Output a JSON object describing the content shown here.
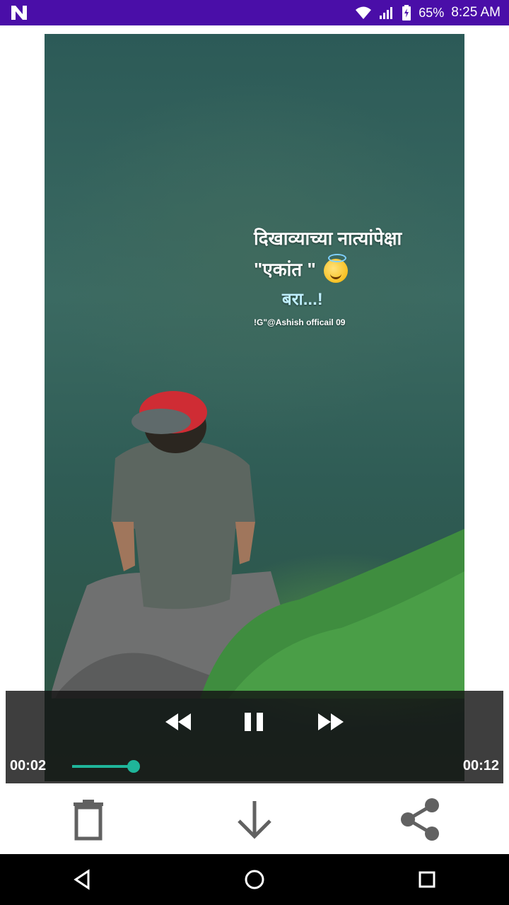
{
  "status_bar": {
    "battery": "65%",
    "time": "8:25 AM",
    "background": "#4a0ea8",
    "icons": [
      "notification-n-icon",
      "wifi-icon",
      "signal-icon",
      "battery-icon"
    ]
  },
  "video": {
    "overlay_text": {
      "line1": "दिखाव्याच्या नात्यांपेक्षा",
      "line2": "\"एकांत \"",
      "line3": "बरा...!",
      "credit": "!G\"@Ashish officail 09"
    }
  },
  "player": {
    "current_time": "00:02",
    "total_time": "00:12",
    "progress_fraction": 0.167,
    "accent": "#1fb59a",
    "buttons": [
      "rewind-icon",
      "pause-icon",
      "fast-forward-icon"
    ]
  },
  "actions": [
    "delete-icon",
    "download-icon",
    "share-icon"
  ],
  "nav": [
    "back-icon",
    "home-icon",
    "recents-icon"
  ]
}
